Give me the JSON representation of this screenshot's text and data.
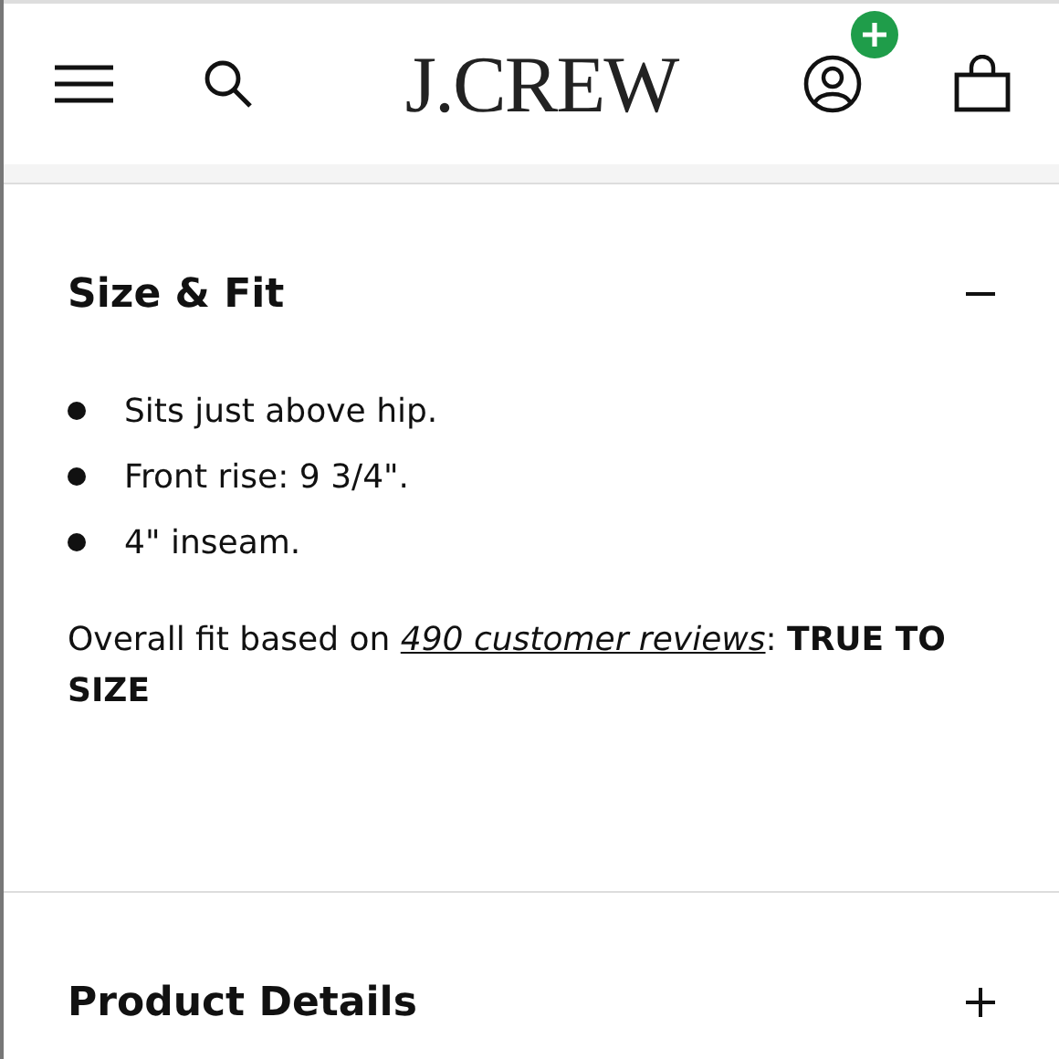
{
  "header": {
    "logo": "J.CREW",
    "account_badge": true
  },
  "sections": [
    {
      "title": "Size & Fit",
      "expanded": true,
      "bullets": [
        "Sits just above hip.",
        "Front rise: 9 3/4\".",
        "4\" inseam."
      ],
      "fit": {
        "prefix": "Overall fit based on ",
        "link": "490 customer reviews",
        "suffix": ": **TRUE TO SIZE**"
      }
    },
    {
      "title": "Product Details",
      "expanded": false
    }
  ]
}
